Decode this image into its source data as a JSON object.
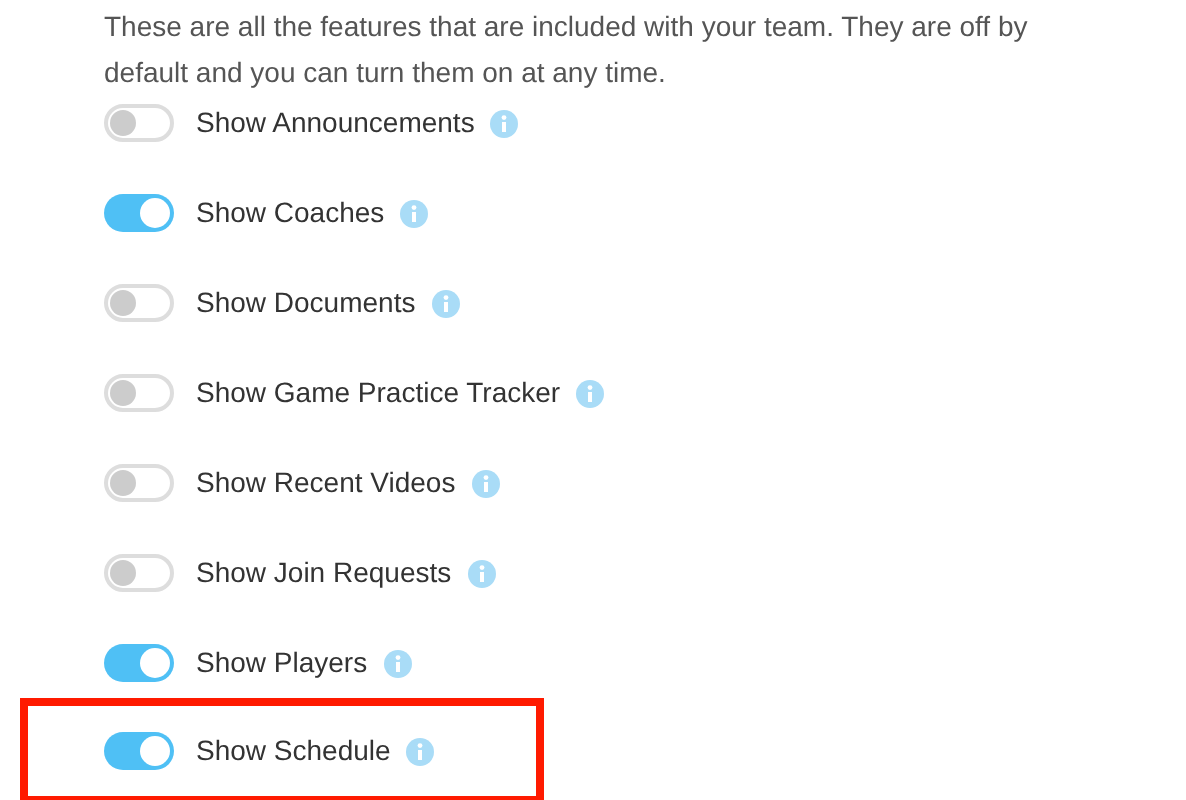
{
  "description": "These are all the features that are included with your team. They are off by default and you can turn them on at any time.",
  "features": [
    {
      "label": "Show Announcements",
      "on": false,
      "highlighted": false
    },
    {
      "label": "Show Coaches",
      "on": true,
      "highlighted": false
    },
    {
      "label": "Show Documents",
      "on": false,
      "highlighted": false
    },
    {
      "label": "Show Game Practice Tracker",
      "on": false,
      "highlighted": false
    },
    {
      "label": "Show Recent Videos",
      "on": false,
      "highlighted": false
    },
    {
      "label": "Show Join Requests",
      "on": false,
      "highlighted": false
    },
    {
      "label": "Show Players",
      "on": true,
      "highlighted": false
    },
    {
      "label": "Show Schedule",
      "on": true,
      "highlighted": true
    }
  ]
}
